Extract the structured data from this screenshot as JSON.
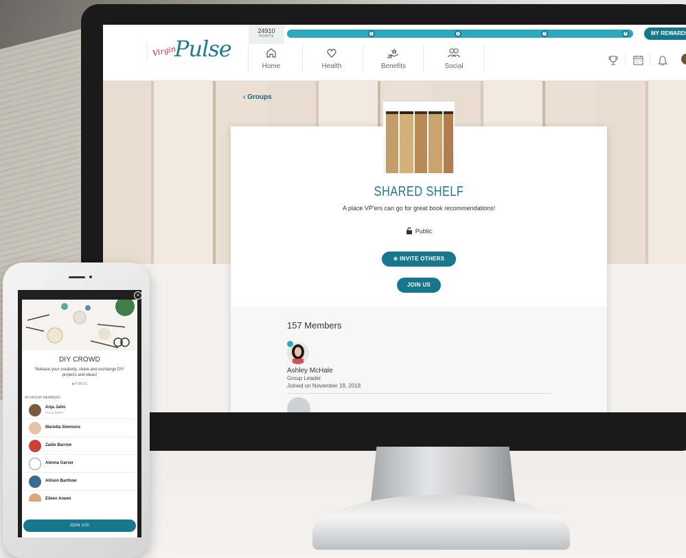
{
  "web": {
    "logo": {
      "virgin": "Virgin",
      "pulse": "Pulse"
    },
    "points": {
      "value": "24910",
      "label": "POINTS"
    },
    "progress": {
      "levels": [
        "1",
        "2",
        "3",
        "4"
      ]
    },
    "rewards_label": "MY REWARDS",
    "nav": [
      {
        "label": "Home",
        "icon": "home-icon"
      },
      {
        "label": "Health",
        "icon": "heart-icon"
      },
      {
        "label": "Benefits",
        "icon": "benefits-icon"
      },
      {
        "label": "Social",
        "icon": "social-icon"
      }
    ],
    "right_icons": [
      "trophy-icon",
      "calendar-icon",
      "bell-icon",
      "profile-avatar"
    ],
    "back_label": "Groups",
    "group": {
      "title": "SHARED SHELF",
      "description": "A place VP'ers can go for great book recommendations!",
      "privacy": "Public",
      "invite_label": "INVITE OTHERS",
      "join_label": "JOIN US"
    },
    "members": {
      "count_label": "157 Members",
      "leader": {
        "name": "Ashley McHale",
        "role": "Group Leader",
        "joined": "Joined on November 19, 2018"
      }
    }
  },
  "mobile": {
    "group": {
      "title": "DIY CROWD",
      "description": "Release your creativity, share and exchange DIY projects and ideas!",
      "privacy": "PUBLIC"
    },
    "member_count_label": "46 GROUP MEMBERS",
    "members": [
      {
        "name": "Anja Jahic",
        "sub": "Group leader"
      },
      {
        "name": "Mariella Simmons",
        "sub": ""
      },
      {
        "name": "Zadie Barrow",
        "sub": ""
      },
      {
        "name": "Alenna Garver",
        "sub": ""
      },
      {
        "name": "Allison Barthow",
        "sub": ""
      },
      {
        "name": "Eileen Arwen",
        "sub": ""
      }
    ],
    "join_label": "JOIN US!"
  },
  "colors": {
    "accent": "#17788b",
    "accent_light": "#2aa9bd",
    "title": "#1f7c8e"
  }
}
